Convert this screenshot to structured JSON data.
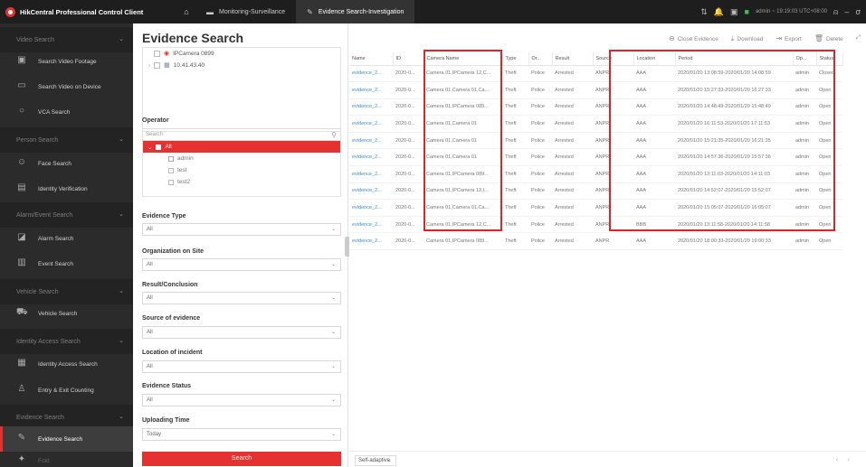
{
  "titlebar": {
    "app_title": "HikCentral Professional Control Client",
    "tabs": [
      {
        "label": "Monitoring-Surveillance",
        "active": false
      },
      {
        "label": "Evidence Search-Investigation",
        "active": true
      }
    ],
    "user_info": "admin ~ 19:19:03 UTC+08:00"
  },
  "sidebar": {
    "groups": {
      "video": "Video Search",
      "person": "Person Search",
      "alarm": "Alarm/Event Search",
      "vehicle": "Vehicle Search",
      "identity": "Identity Access Search",
      "evidence": "Evidence Search"
    },
    "items": {
      "video_footage": "Search Video Footage",
      "video_device": "Search Video on Device",
      "vca": "VCA Search",
      "face": "Face Search",
      "identity_verification": "Identity Verification",
      "alarm": "Alarm Search",
      "event": "Event Search",
      "vehicle": "Vehicle Search",
      "identity_access": "Identity Access Search",
      "entry_exit": "Entry & Exit Counting",
      "evidence": "Evidence Search",
      "fold": "Fold"
    }
  },
  "panel": {
    "title": "Evidence Search",
    "tree": {
      "camera": "IPCamera 0899",
      "ip": "10.41.43.40"
    },
    "operator_label": "Operator",
    "operator_search_placeholder": "Search",
    "operator_all": "All",
    "operators": [
      "admin",
      "test",
      "test2"
    ],
    "filters": {
      "evidence_type": {
        "label": "Evidence Type",
        "value": "All"
      },
      "organization": {
        "label": "Organization on Site",
        "value": "All"
      },
      "result": {
        "label": "Result/Conclusion",
        "value": "All"
      },
      "source": {
        "label": "Source of evidence",
        "value": "All"
      },
      "location": {
        "label": "Location of incident",
        "value": "All"
      },
      "status": {
        "label": "Evidence Status",
        "value": "All"
      },
      "uploading_time": {
        "label": "Uploading Time",
        "value": "Today"
      }
    },
    "search_button": "Search"
  },
  "toolbar": {
    "close_evidence": "Close Evidence",
    "download": "Download",
    "export": "Export",
    "delete": "Delete"
  },
  "table": {
    "headers": [
      "Name",
      "ID",
      "Camera Name",
      "Type",
      "Or...",
      "Result",
      "Source",
      "Location",
      "Period",
      "Op...",
      "Status"
    ],
    "rows": [
      [
        "evidence_2...",
        "2020-0...",
        "Camera 01,IPCamera 12,C...",
        "Theft",
        "Police",
        "Arrested",
        "ANPR",
        "AAA",
        "2020/01/20 13:08:59-2020/01/20 14:08:59",
        "admin",
        "Closed"
      ],
      [
        "evidence_2...",
        "2020-0...",
        "Camera 01,Camera 01,Ca...",
        "Theft",
        "Police",
        "Arrested",
        "ANPR",
        "AAA",
        "2020/01/20 15:27:33-2020/01/20 16:27:33",
        "admin",
        "Open"
      ],
      [
        "evidence_2...",
        "2020-0...",
        "Camera 01,IPCamera 089...",
        "Theft",
        "Police",
        "Arrested",
        "ANPR",
        "AAA",
        "2020/01/20 14:48:49-2020/01/20 15:48:49",
        "admin",
        "Open"
      ],
      [
        "evidence_2...",
        "2020-0...",
        "Camera 01,Camera 01",
        "Theft",
        "Police",
        "Arrested",
        "ANPR",
        "AAA",
        "2020/01/20 16:11:53-2020/01/20 17:11:53",
        "admin",
        "Open"
      ],
      [
        "evidence_2...",
        "2020-0...",
        "Camera 01,Camera 01",
        "Theft",
        "Police",
        "Arrested",
        "ANPR",
        "AAA",
        "2020/01/20 15:21:35-2020/01/20 16:21:35",
        "admin",
        "Open"
      ],
      [
        "evidence_2...",
        "2020-0...",
        "Camera 01,Camera 01",
        "Theft",
        "Police",
        "Arrested",
        "ANPR",
        "AAA",
        "2020/01/20 14:57:36-2020/01/20 15:57:36",
        "admin",
        "Open"
      ],
      [
        "evidence_2...",
        "2020-0...",
        "Camera 01,IPCamera 089...",
        "Theft",
        "Police",
        "Arrested",
        "ANPR",
        "AAA",
        "2020/01/20 13:11:03-2020/01/20 14:11:03",
        "admin",
        "Open"
      ],
      [
        "evidence_2...",
        "2020-0...",
        "Camera 01,IPCamera 12,I...",
        "Theft",
        "Police",
        "Arrested",
        "ANPR",
        "AAA",
        "2020/01/20 14:52:07-2020/01/20 15:52:07",
        "admin",
        "Open"
      ],
      [
        "evidence_2...",
        "2020-0...",
        "Camera 01,Camera 01,Ca...",
        "Theft",
        "Police",
        "Arrested",
        "ANPR",
        "AAA",
        "2020/01/20 15:05:07-2020/01/20 16:05:07",
        "admin",
        "Open"
      ],
      [
        "evidence_2...",
        "2020-0...",
        "Camera 01,IPCamera 12,C...",
        "Theft",
        "Police",
        "Arrested",
        "ANPR",
        "BBB",
        "2020/01/20 13:11:58-2020/01/20 14:11:58",
        "admin",
        "Open"
      ],
      [
        "evidence_2...",
        "2020-0...",
        "Camera 01,IPCamera 089...",
        "Theft",
        "Police",
        "Arrested",
        "ANPR",
        "AAA",
        "2020/01/20 18:00:33-2020/01/20 19:00:33",
        "admin",
        "Open"
      ]
    ]
  },
  "footer": {
    "page_size": "Self-adaptive"
  },
  "colors": {
    "accent": "#e5312f",
    "link": "#3a8ed9",
    "sidebar_bg": "#2b2b2b",
    "titlebar_bg": "#1e1e1e"
  }
}
